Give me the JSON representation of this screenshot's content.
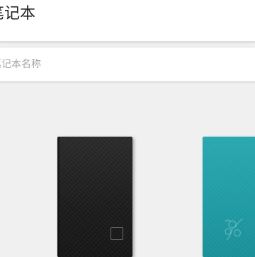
{
  "header": {
    "title": "笔记本"
  },
  "search": {
    "placeholder": "笔记本名称"
  },
  "notebooks": [
    {
      "cover": "black"
    },
    {
      "cover": "teal"
    }
  ],
  "colors": {
    "black_cover": "#1e1e1e",
    "teal_cover": "#22a0a9",
    "background": "#f0f0f0"
  }
}
